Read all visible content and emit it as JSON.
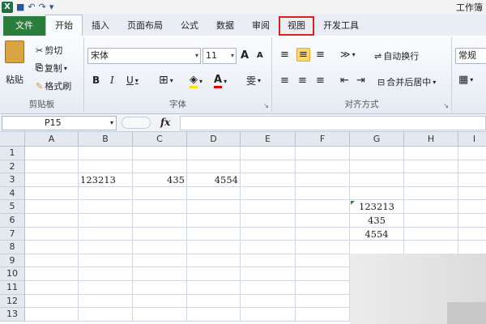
{
  "window": {
    "title": "工作簿"
  },
  "tabs": [
    "文件",
    "开始",
    "插入",
    "页面布局",
    "公式",
    "数据",
    "审阅",
    "视图",
    "开发工具"
  ],
  "clipboard": {
    "paste": "粘贴",
    "cut": "剪切",
    "copy": "复制",
    "format_painter": "格式刷",
    "label": "剪贴板"
  },
  "font": {
    "name": "宋体",
    "size": "11",
    "label": "字体",
    "bold": "B",
    "italic": "I",
    "underline": "U",
    "grow": "A",
    "shrink": "A",
    "wen": "雯"
  },
  "alignment": {
    "wrap": "自动换行",
    "merge": "合并后居中",
    "label": "对齐方式"
  },
  "number": {
    "format": "常规"
  },
  "formula_bar": {
    "name_box": "P15",
    "fx": "fx",
    "value": ""
  },
  "columns": [
    "A",
    "B",
    "C",
    "D",
    "E",
    "F",
    "G",
    "H",
    "I"
  ],
  "rows": [
    "1",
    "2",
    "3",
    "4",
    "5",
    "6",
    "7",
    "8",
    "9",
    "10",
    "11",
    "12",
    "13"
  ],
  "cells": {
    "B3": "123213",
    "C3": "435",
    "D3": "4554",
    "G5": "123213",
    "G6": "435",
    "G7": "4554"
  }
}
